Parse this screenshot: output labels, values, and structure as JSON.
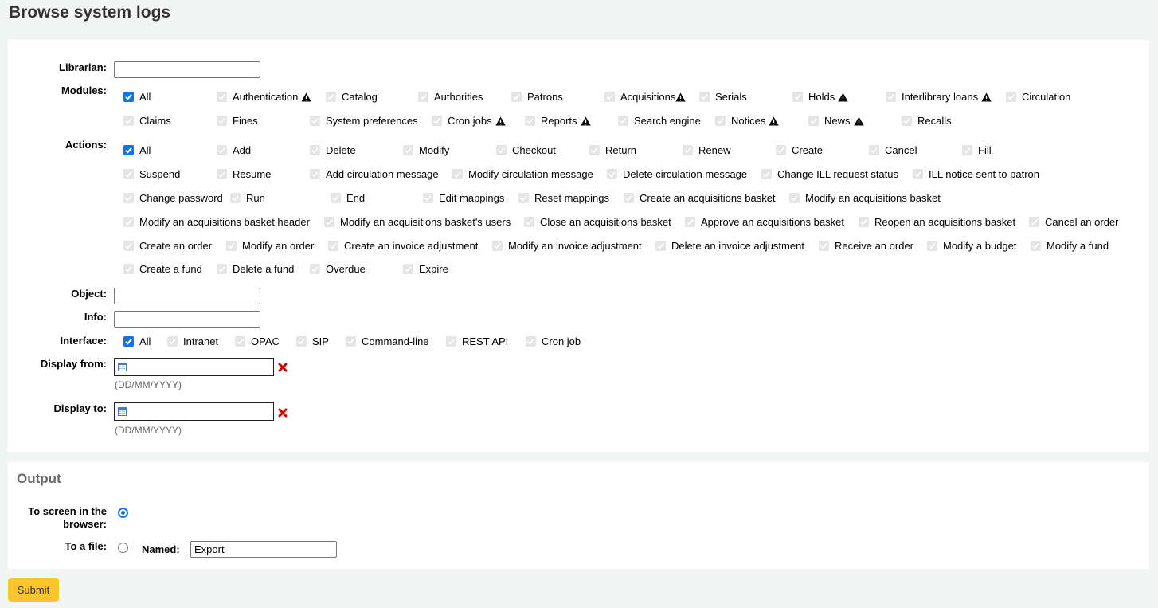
{
  "page": {
    "title": "Browse system logs"
  },
  "filters": {
    "librarian": {
      "label": "Librarian:",
      "value": ""
    },
    "modules": {
      "label": "Modules:",
      "items": [
        {
          "label": "All",
          "checked": true,
          "disabled": false,
          "warning": false
        },
        {
          "label": "Authentication",
          "checked": true,
          "disabled": true,
          "warning": true
        },
        {
          "label": "Catalog",
          "checked": true,
          "disabled": true,
          "warning": false
        },
        {
          "label": "Authorities",
          "checked": true,
          "disabled": true,
          "warning": false
        },
        {
          "label": "Patrons",
          "checked": true,
          "disabled": true,
          "warning": false
        },
        {
          "label": "Acquisitions",
          "checked": true,
          "disabled": true,
          "warning": true
        },
        {
          "label": "Serials",
          "checked": true,
          "disabled": true,
          "warning": false
        },
        {
          "label": "Holds",
          "checked": true,
          "disabled": true,
          "warning": true
        },
        {
          "label": "Interlibrary loans",
          "checked": true,
          "disabled": true,
          "warning": true
        },
        {
          "label": "Circulation",
          "checked": true,
          "disabled": true,
          "warning": false
        },
        {
          "label": "Claims",
          "checked": true,
          "disabled": true,
          "warning": false
        },
        {
          "label": "Fines",
          "checked": true,
          "disabled": true,
          "warning": false
        },
        {
          "label": "System preferences",
          "checked": true,
          "disabled": true,
          "warning": false
        },
        {
          "label": "Cron jobs",
          "checked": true,
          "disabled": true,
          "warning": true
        },
        {
          "label": "Reports",
          "checked": true,
          "disabled": true,
          "warning": true
        },
        {
          "label": "Search engine",
          "checked": true,
          "disabled": true,
          "warning": false
        },
        {
          "label": "Notices",
          "checked": true,
          "disabled": true,
          "warning": true
        },
        {
          "label": "News",
          "checked": true,
          "disabled": true,
          "warning": true
        },
        {
          "label": "Recalls",
          "checked": true,
          "disabled": true,
          "warning": false
        }
      ]
    },
    "actions": {
      "label": "Actions:",
      "items": [
        {
          "label": "All",
          "checked": true,
          "disabled": false
        },
        {
          "label": "Add",
          "checked": true,
          "disabled": true
        },
        {
          "label": "Delete",
          "checked": true,
          "disabled": true
        },
        {
          "label": "Modify",
          "checked": true,
          "disabled": true
        },
        {
          "label": "Checkout",
          "checked": true,
          "disabled": true
        },
        {
          "label": "Return",
          "checked": true,
          "disabled": true
        },
        {
          "label": "Renew",
          "checked": true,
          "disabled": true
        },
        {
          "label": "Create",
          "checked": true,
          "disabled": true
        },
        {
          "label": "Cancel",
          "checked": true,
          "disabled": true
        },
        {
          "label": "Fill",
          "checked": true,
          "disabled": true
        },
        {
          "label": "Suspend",
          "checked": true,
          "disabled": true
        },
        {
          "label": "Resume",
          "checked": true,
          "disabled": true
        },
        {
          "label": "Add circulation message",
          "checked": true,
          "disabled": true
        },
        {
          "label": "Modify circulation message",
          "checked": true,
          "disabled": true
        },
        {
          "label": "Delete circulation message",
          "checked": true,
          "disabled": true
        },
        {
          "label": "Change ILL request status",
          "checked": true,
          "disabled": true
        },
        {
          "label": "ILL notice sent to patron",
          "checked": true,
          "disabled": true
        },
        {
          "label": "Change password",
          "checked": true,
          "disabled": true
        },
        {
          "label": "Run",
          "checked": true,
          "disabled": true
        },
        {
          "label": "End",
          "checked": true,
          "disabled": true
        },
        {
          "label": "Edit mappings",
          "checked": true,
          "disabled": true
        },
        {
          "label": "Reset mappings",
          "checked": true,
          "disabled": true
        },
        {
          "label": "Create an acquisitions basket",
          "checked": true,
          "disabled": true
        },
        {
          "label": "Modify an acquisitions basket",
          "checked": true,
          "disabled": true
        },
        {
          "label": "Modify an acquisitions basket header",
          "checked": true,
          "disabled": true
        },
        {
          "label": "Modify an acquisitions basket's users",
          "checked": true,
          "disabled": true
        },
        {
          "label": "Close an acquisitions basket",
          "checked": true,
          "disabled": true
        },
        {
          "label": "Approve an acquisitions basket",
          "checked": true,
          "disabled": true
        },
        {
          "label": "Reopen an acquisitions basket",
          "checked": true,
          "disabled": true
        },
        {
          "label": "Cancel an order",
          "checked": true,
          "disabled": true
        },
        {
          "label": "Create an order",
          "checked": true,
          "disabled": true
        },
        {
          "label": "Modify an order",
          "checked": true,
          "disabled": true
        },
        {
          "label": "Create an invoice adjustment",
          "checked": true,
          "disabled": true
        },
        {
          "label": "Modify an invoice adjustment",
          "checked": true,
          "disabled": true
        },
        {
          "label": "Delete an invoice adjustment",
          "checked": true,
          "disabled": true
        },
        {
          "label": "Receive an order",
          "checked": true,
          "disabled": true
        },
        {
          "label": "Modify a budget",
          "checked": true,
          "disabled": true
        },
        {
          "label": "Modify a fund",
          "checked": true,
          "disabled": true
        },
        {
          "label": "Create a fund",
          "checked": true,
          "disabled": true
        },
        {
          "label": "Delete a fund",
          "checked": true,
          "disabled": true
        },
        {
          "label": "Overdue",
          "checked": true,
          "disabled": true
        },
        {
          "label": "Expire",
          "checked": true,
          "disabled": true
        }
      ]
    },
    "object": {
      "label": "Object:",
      "value": ""
    },
    "info": {
      "label": "Info:",
      "value": ""
    },
    "interface": {
      "label": "Interface:",
      "items": [
        {
          "label": "All",
          "checked": true,
          "disabled": false
        },
        {
          "label": "Intranet",
          "checked": true,
          "disabled": true
        },
        {
          "label": "OPAC",
          "checked": true,
          "disabled": true
        },
        {
          "label": "SIP",
          "checked": true,
          "disabled": true
        },
        {
          "label": "Command-line",
          "checked": true,
          "disabled": true
        },
        {
          "label": "REST API",
          "checked": true,
          "disabled": true
        },
        {
          "label": "Cron job",
          "checked": true,
          "disabled": true
        }
      ]
    },
    "display_from": {
      "label": "Display from:",
      "value": "",
      "hint": "(DD/MM/YYYY)"
    },
    "display_to": {
      "label": "Display to:",
      "value": "",
      "hint": "(DD/MM/YYYY)"
    }
  },
  "output": {
    "title": "Output",
    "to_screen": {
      "label_line1": "To screen in the",
      "label_line2": "browser:",
      "selected": true
    },
    "to_file": {
      "label": "To a file:",
      "selected": false,
      "named_label": "Named:",
      "filename": "Export"
    }
  },
  "submit_label": "Submit"
}
